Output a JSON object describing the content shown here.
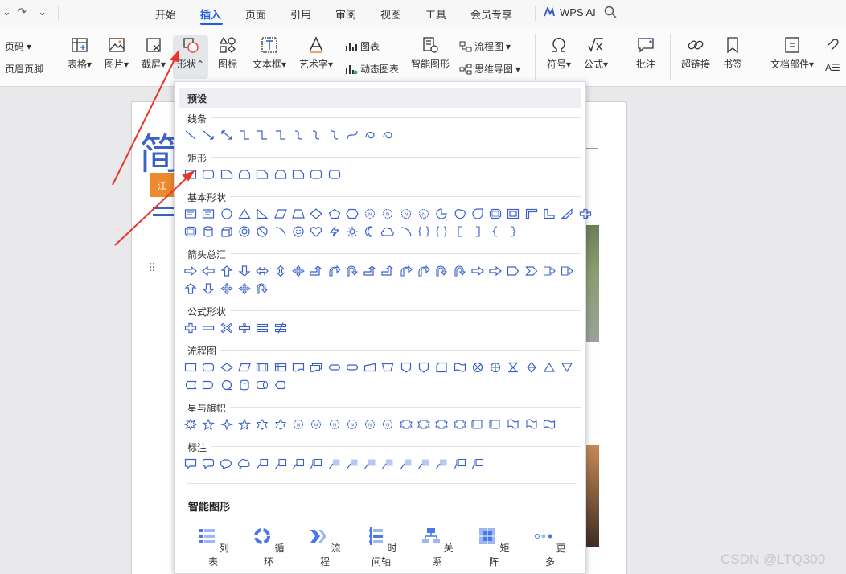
{
  "quick_access": {
    "undo": "↷",
    "dropdown": "⌄"
  },
  "menu_tabs": [
    "开始",
    "插入",
    "页面",
    "引用",
    "审阅",
    "视图",
    "工具",
    "会员专享"
  ],
  "wps_ai": "WPS AI",
  "ribbon": {
    "page_number": "页码",
    "header_footer": "页眉页脚",
    "table": "表格",
    "picture": "图片",
    "screenshot": "截屏",
    "shape": "形状",
    "icon": "图标",
    "textbox": "文本框",
    "wordart": "艺术字",
    "chart": "图表",
    "dynamic_chart": "动态图表",
    "smart_graphic": "智能图形",
    "flowchart": "流程图",
    "mindmap": "思维导图",
    "symbol": "符号",
    "formula": "公式",
    "comment": "批注",
    "hyperlink": "超链接",
    "bookmark": "书签",
    "doc_parts": "文档部件"
  },
  "document": {
    "title_char": "简",
    "tag_text": "江"
  },
  "panel": {
    "preset": "预设",
    "categories": {
      "lines": "线条",
      "rectangles": "矩形",
      "basic": "基本形状",
      "arrows": "箭头总汇",
      "equation": "公式形状",
      "flowchart": "流程图",
      "stars": "星与旗帜",
      "callouts": "标注"
    },
    "smart_title": "智能图形",
    "smart_items": [
      "列表",
      "循环",
      "流程",
      "时间轴",
      "关系",
      "矩阵",
      "更多"
    ]
  },
  "colors": {
    "accent": "#1f5ee0",
    "shape_stroke": "#3a5fcd",
    "arrow": "#e8362b"
  },
  "watermark": "CSDN @LTQ300"
}
